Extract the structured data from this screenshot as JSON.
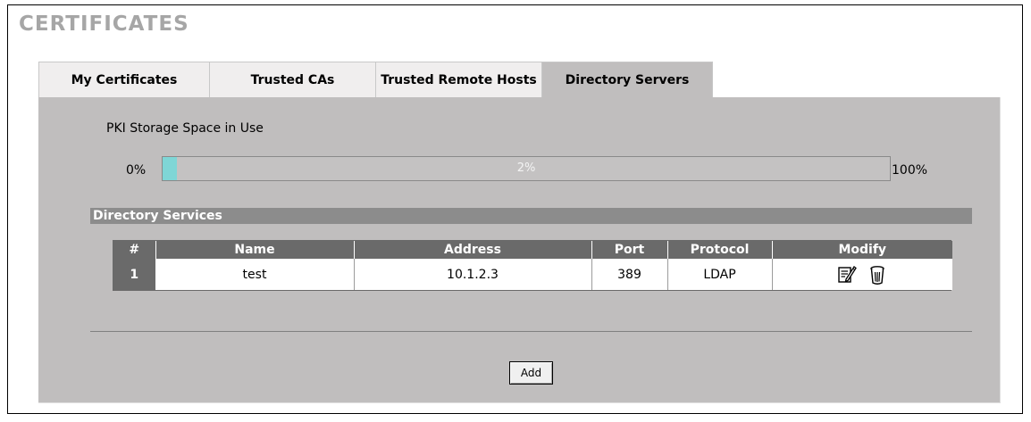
{
  "page": {
    "title": "CERTIFICATES"
  },
  "tabs": [
    {
      "label": "My Certificates",
      "active": false
    },
    {
      "label": "Trusted CAs",
      "active": false
    },
    {
      "label": "Trusted Remote Hosts",
      "active": false
    },
    {
      "label": "Directory Servers",
      "active": true
    }
  ],
  "storage": {
    "label": "PKI Storage Space in Use",
    "min_label": "0%",
    "max_label": "100%",
    "used_text": "2%",
    "used_fraction": 0.02,
    "fill_color": "#7fd6d6"
  },
  "directory_services": {
    "title": "Directory Services",
    "columns": [
      "#",
      "Name",
      "Address",
      "Port",
      "Protocol",
      "Modify"
    ],
    "rows": [
      {
        "index": "1",
        "name": "test",
        "address": "10.1.2.3",
        "port": "389",
        "protocol": "LDAP",
        "actions": [
          "edit-icon",
          "delete-icon"
        ]
      }
    ]
  },
  "buttons": {
    "add_label": "Add"
  }
}
